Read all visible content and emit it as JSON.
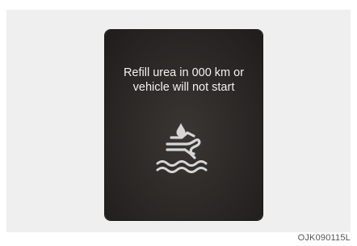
{
  "display": {
    "message_line1": "Refill urea in 000 km or",
    "message_line2": "vehicle will not start",
    "icon": "urea-level-warning-icon",
    "text_color": "#f2f2f2",
    "background_color": "#2b2826",
    "icon_color": "#d6d6d6"
  },
  "caption": {
    "code": "OJK090115L"
  }
}
